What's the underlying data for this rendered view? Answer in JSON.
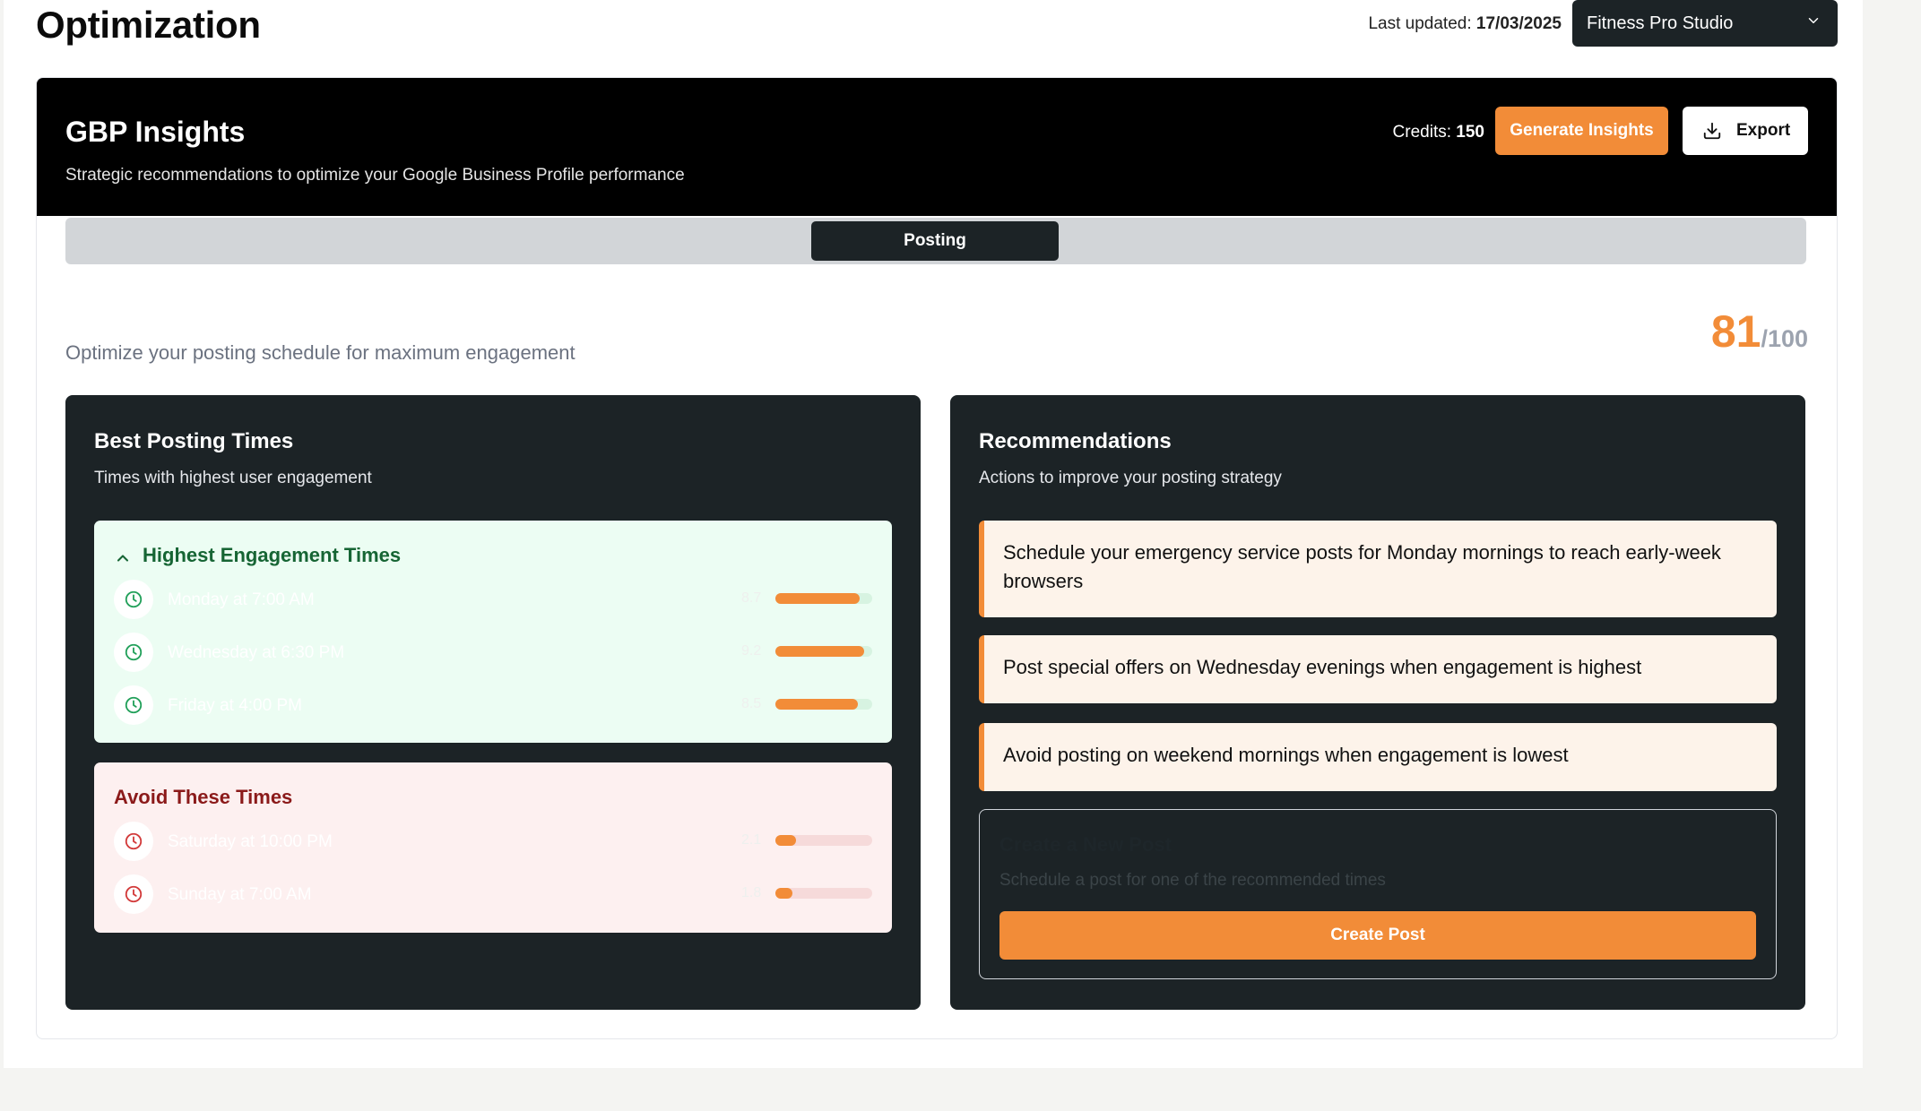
{
  "header": {
    "title": "Optimization",
    "last_updated_label": "Last updated:",
    "last_updated_value": "17/03/2025",
    "business_select": "Fitness Pro Studio"
  },
  "banner": {
    "title": "GBP Insights",
    "subtitle": "Strategic recommendations to optimize your Google Business Profile performance",
    "credits_label": "Credits:",
    "credits_value": "150",
    "generate_label": "Generate Insights",
    "export_label": "Export"
  },
  "tabs": [
    {
      "label": "Posting",
      "active": true
    }
  ],
  "section": {
    "description": "Optimize your posting schedule for maximum engagement",
    "score": "81",
    "score_max": "/100"
  },
  "best_times": {
    "title": "Best Posting Times",
    "subtitle": "Times with highest user engagement",
    "highest": {
      "heading": "Highest Engagement Times",
      "items": [
        {
          "label": "Monday at 7:00 AM",
          "score": "8.7",
          "fill": 0.87
        },
        {
          "label": "Wednesday at 6:30 PM",
          "score": "9.2",
          "fill": 0.92
        },
        {
          "label": "Friday at 4:00 PM",
          "score": "8.5",
          "fill": 0.85
        }
      ]
    },
    "avoid": {
      "heading": "Avoid These Times",
      "items": [
        {
          "label": "Saturday at 10:00 PM",
          "score": "2.1",
          "fill": 0.21
        },
        {
          "label": "Sunday at 7:00 AM",
          "score": "1.8",
          "fill": 0.18
        }
      ]
    }
  },
  "recommendations": {
    "title": "Recommendations",
    "subtitle": "Actions to improve your posting strategy",
    "items": [
      "Schedule your emergency service posts for Monday mornings to reach early-week browsers",
      "Post special offers on Wednesday evenings when engagement is highest",
      "Avoid posting on weekend mornings when engagement is lowest"
    ],
    "new_post": {
      "title": "Create a New Post",
      "subtitle": "Schedule a post for one of the recommended times",
      "button_label": "Create Post"
    }
  },
  "colors": {
    "accent": "#f28c38",
    "panel": "#1c2326",
    "good": "#166534",
    "bad": "#8b1a1a"
  }
}
